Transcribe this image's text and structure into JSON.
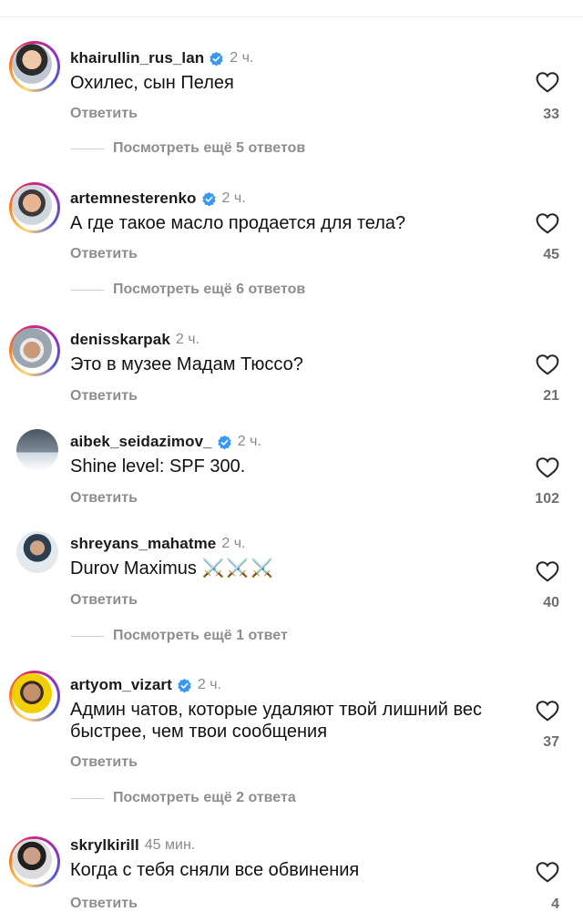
{
  "comments": [
    {
      "username": "khairullin_rus_lan",
      "verified": true,
      "time": "2 ч.",
      "text": "Охилес, сын Пелея",
      "reply": "Ответить",
      "likes": "33",
      "more": "Посмотреть ещё 5 ответов"
    },
    {
      "username": "artemnesterenko",
      "verified": true,
      "time": "2 ч.",
      "text": "А где такое масло продается для тела?",
      "reply": "Ответить",
      "likes": "45",
      "more": "Посмотреть ещё 6 ответов"
    },
    {
      "username": "denisskarpak",
      "verified": false,
      "time": "2 ч.",
      "text": "Это в музее Мадам Тюссо?",
      "reply": "Ответить",
      "likes": "21"
    },
    {
      "username": "aibek_seidazimov_",
      "verified": true,
      "time": "2 ч.",
      "text": "Shine level: SPF 300.",
      "reply": "Ответить",
      "likes": "102"
    },
    {
      "username": "shreyans_mahatme",
      "verified": false,
      "time": "2 ч.",
      "text": "Durov Maximus",
      "emoji": "⚔️⚔️⚔️",
      "reply": "Ответить",
      "likes": "40",
      "more": "Посмотреть ещё 1 ответ"
    },
    {
      "username": "artyom_vizart",
      "verified": true,
      "time": "2 ч.",
      "text": "Админ чатов, которые удаляют твой лишний вес быстрее, чем твои сообщения",
      "reply": "Ответить",
      "likes": "37",
      "more": "Посмотреть ещё 2 ответа"
    },
    {
      "username": "skrylkirill",
      "verified": false,
      "time": "45 мин.",
      "text": "Когда с тебя сняли все обвинения",
      "reply": "Ответить",
      "likes": "4"
    }
  ],
  "colors": {
    "verified": "#3897f0",
    "muted": "#8e8e8e"
  }
}
